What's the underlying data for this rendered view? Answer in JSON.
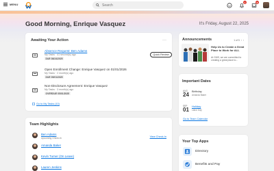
{
  "topbar": {
    "menu_label": "MENU",
    "search_placeholder": "Search",
    "notifications_badge": "1",
    "inbox_badge": "8"
  },
  "hero": {
    "greeting": "Good Morning, Enrique Vasquez",
    "date": "It's Friday, August 22, 2025"
  },
  "awaiting": {
    "title": "Awaiting Your Action",
    "more": "···",
    "tasks": [
      {
        "title": "Absence Request: Ben Adams",
        "sub": "My Tasks · 41 second(s) ago",
        "due": "DUE 08/24/2025",
        "button": "Quick Review"
      },
      {
        "title": "Open Enrollment Change: Enrique Vasquez on 01/01/2026",
        "sub": "My Tasks · 2 month(s) ago",
        "due": "DUE 09/01/2025"
      },
      {
        "title": "Non-Disclosure Agreement: Enrique Vasquez",
        "sub": "My Tasks · 3 month(s) ago",
        "due": "OVERDUE 05/01/2025"
      }
    ],
    "goto_label": "Go to My Tasks (10)"
  },
  "team": {
    "title": "Team Highlights",
    "members": [
      {
        "name": "Ben Adams",
        "sub": "Upcoming Check-In"
      },
      {
        "name": "Amanda Baker",
        "sub": ""
      },
      {
        "name": "Kevin Turner (On Leave)",
        "sub": ""
      },
      {
        "name": "Lauren Jenkins",
        "sub": ""
      }
    ],
    "view_checkin": "View Check-In"
  },
  "announcements": {
    "title": "Announcements",
    "pager": "1 of 5",
    "headline": "Help Us to Create a Great Place to Work for ALL",
    "body": "At GMS, we are committed to creating a great place to..."
  },
  "important_dates": {
    "title": "Important Dates",
    "events": [
      {
        "month": "AUG",
        "day": "24",
        "name": "Birthday",
        "sub": "Amanda Baker"
      },
      {
        "month": "SEP",
        "day": "01",
        "name": "Holiday",
        "sub": "Labor Day"
      }
    ],
    "goto_label": "Go to Team Calendar"
  },
  "apps": {
    "title": "Your Top Apps",
    "items": [
      {
        "label": "Directory",
        "icon": "directory-icon"
      },
      {
        "label": "Benefits and Pay",
        "icon": "benefits-icon"
      }
    ]
  },
  "colors": {
    "accent": "#0875e1",
    "brand_orange": "#f38b00",
    "badge": "#de3b2f"
  }
}
